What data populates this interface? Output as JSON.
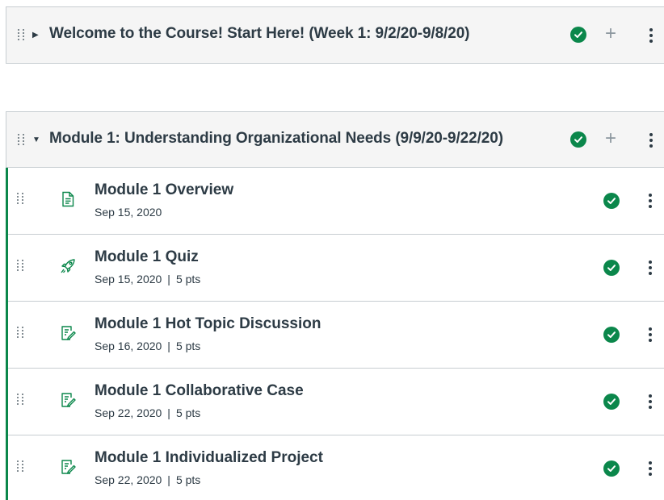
{
  "modules": [
    {
      "title": "Welcome to the Course! Start Here! (Week 1: 9/2/20-9/8/20)",
      "expanded": false,
      "published": true
    },
    {
      "title": "Module 1: Understanding Organizational Needs (9/9/20-9/22/20)",
      "expanded": true,
      "published": true,
      "items": [
        {
          "title": "Module 1 Overview",
          "date": "Sep 15, 2020",
          "pts": "",
          "type": "page-icon",
          "published": true
        },
        {
          "title": "Module 1 Quiz",
          "date": "Sep 15, 2020",
          "pts": "5 pts",
          "type": "quiz-icon",
          "published": true
        },
        {
          "title": "Module 1 Hot Topic Discussion",
          "date": "Sep 16, 2020",
          "pts": "5 pts",
          "type": "assignment-icon",
          "published": true
        },
        {
          "title": "Module 1 Collaborative Case",
          "date": "Sep 22, 2020",
          "pts": "5 pts",
          "type": "assignment-icon",
          "published": true
        },
        {
          "title": "Module 1 Individualized Project",
          "date": "Sep 22, 2020",
          "pts": "5 pts",
          "type": "assignment-icon",
          "published": true
        }
      ]
    }
  ],
  "colors": {
    "accent_green": "#0b874b",
    "header_bg": "#f5f5f5",
    "border": "#c7cdd1",
    "text": "#2d3b45"
  }
}
